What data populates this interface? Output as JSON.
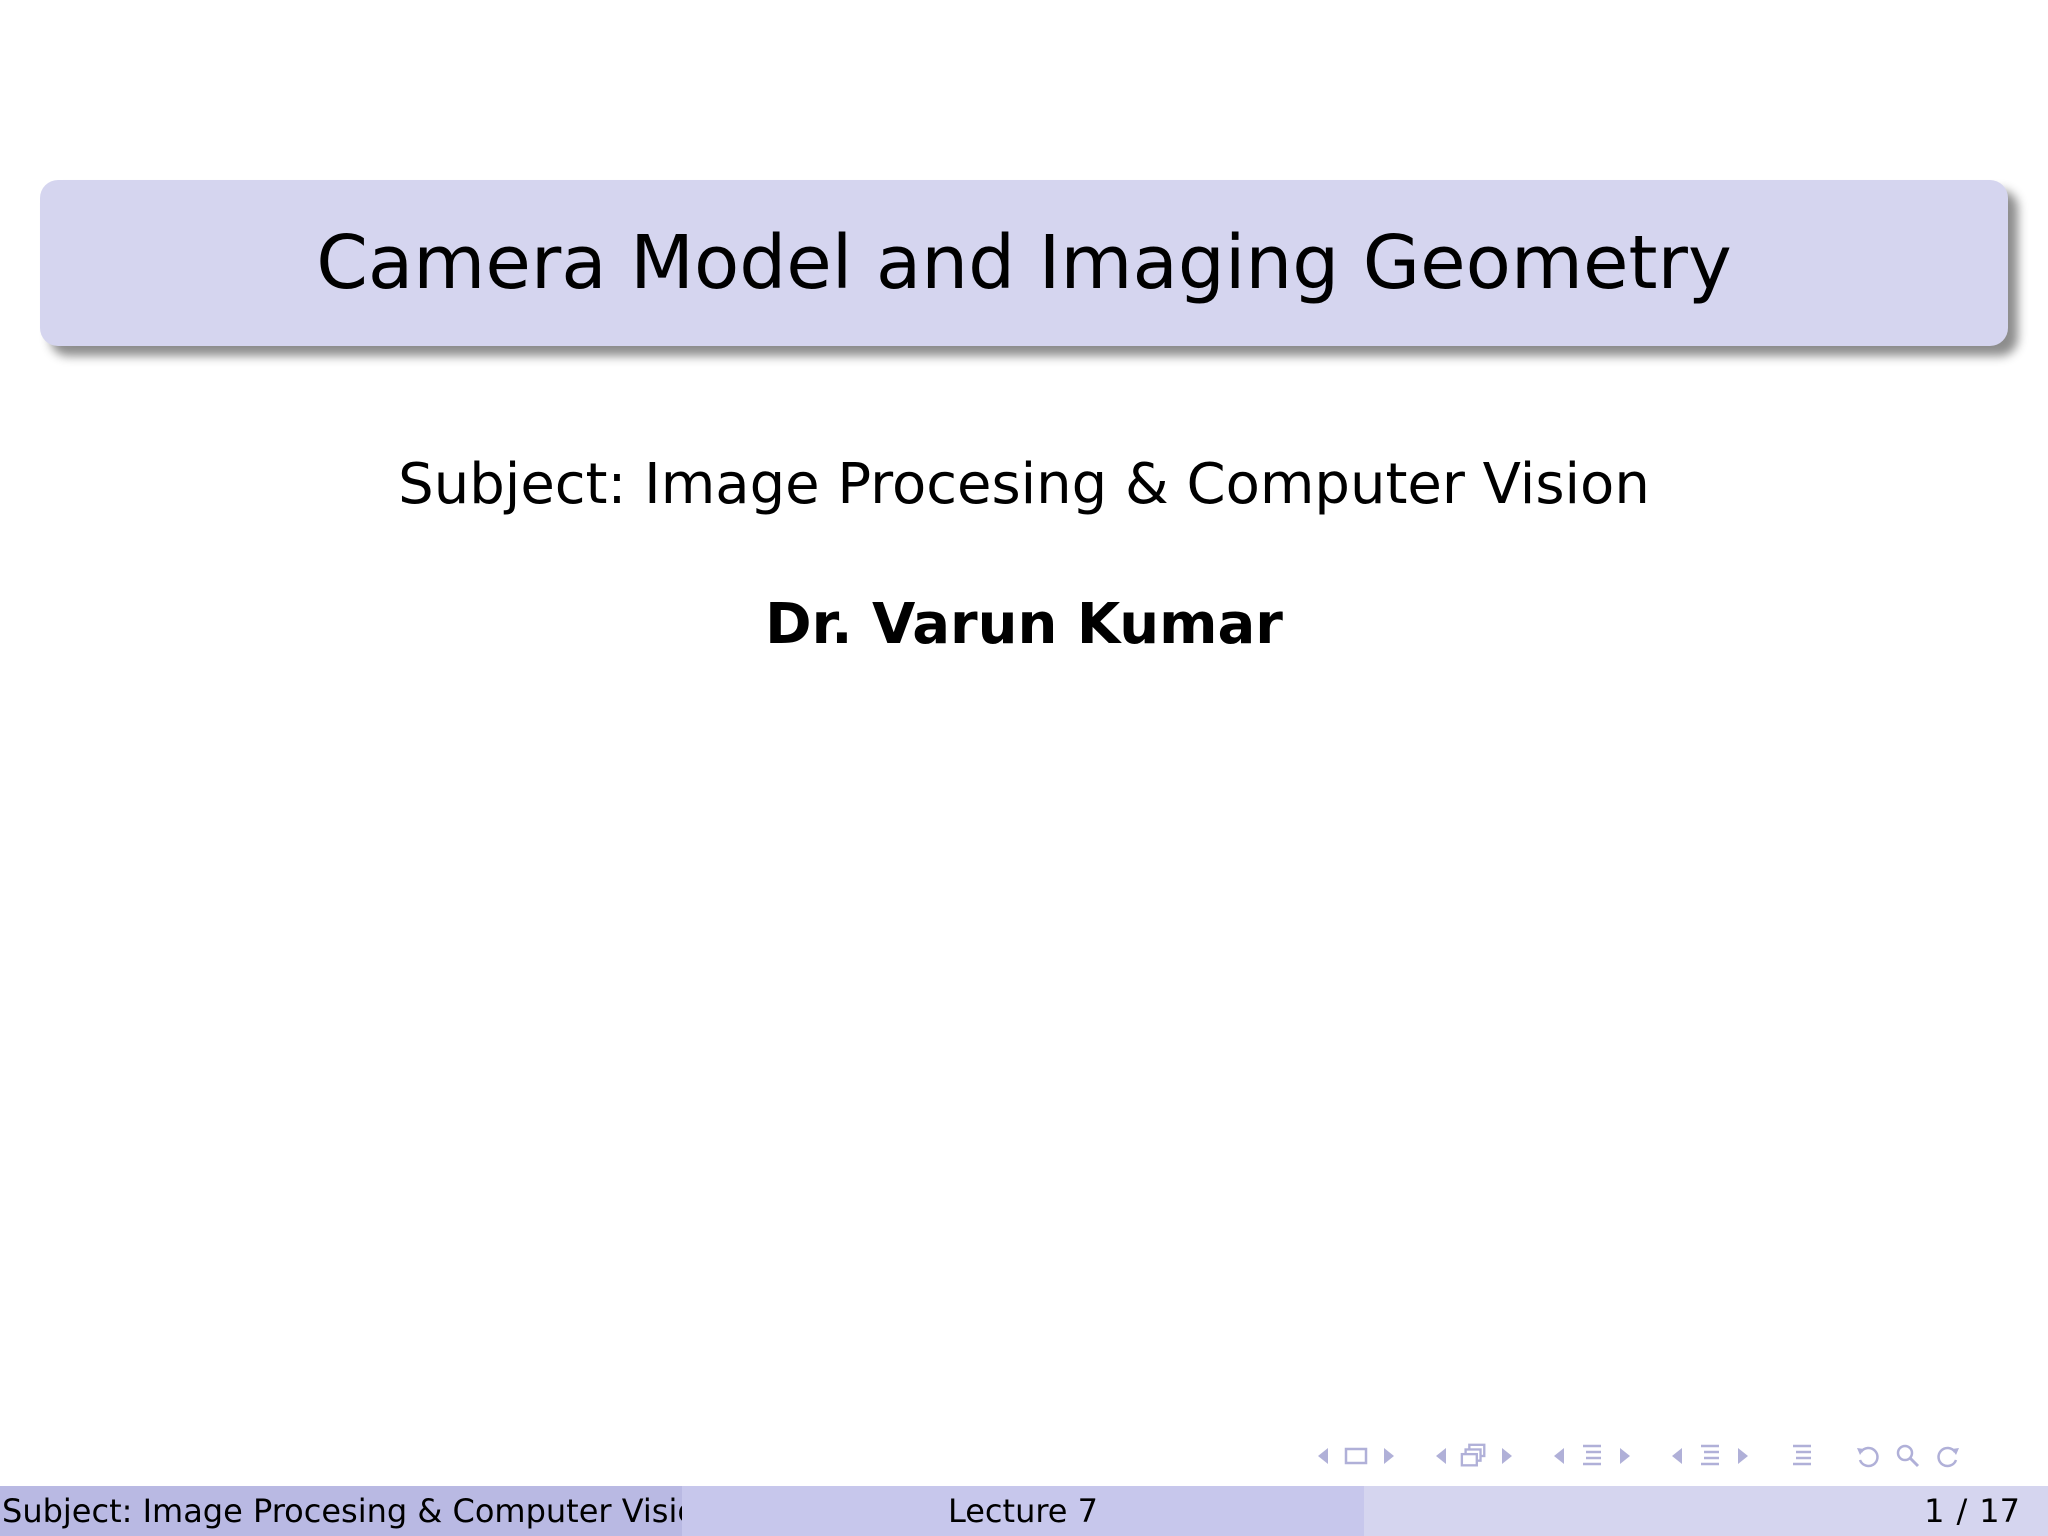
{
  "slide": {
    "title": "Camera Model and Imaging Geometry",
    "subject": "Subject: Image Procesing & Computer Vision",
    "author": "Dr.  Varun Kumar"
  },
  "footer": {
    "left": "Subject: Image Procesing & Computer Vision",
    "center": "Lecture 7",
    "page_current": "1",
    "page_separator": "/",
    "page_total": "17"
  },
  "colors": {
    "title_bg": "#d5d5ef",
    "footer_left_bg": "#b9b9e3",
    "footer_mid_bg": "#c7c7ec",
    "footer_right_bg": "#d5d5ef",
    "nav_symbol": "#b0b0d8"
  },
  "nav_icons": [
    "frame-icon",
    "subsection-icon",
    "section-icon",
    "document-icon",
    "outline-icon",
    "undo-icon",
    "search-icon",
    "redo-icon"
  ]
}
